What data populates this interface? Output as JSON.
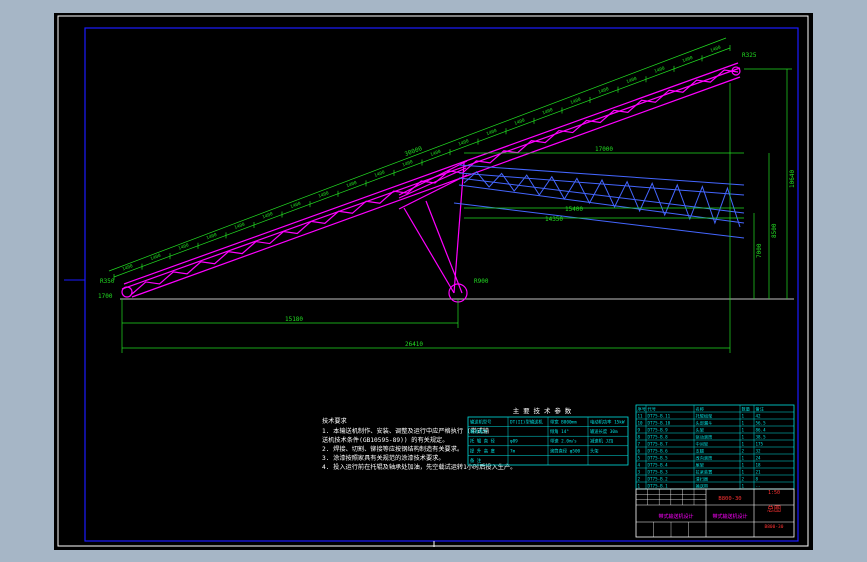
{
  "colors": {
    "background": "#a6b6c6",
    "sheet": "#000000",
    "frame": "#ffffff",
    "border": "#1a1aff",
    "structure": "#ff00ff",
    "dimensions": "#22dd22",
    "notes": "#ffffff",
    "title_block": "#00e0e0",
    "highlight": "#ff3333"
  },
  "dimensions": {
    "total_length": "26410",
    "bottom_length": "15180",
    "belt_length": "30000",
    "left_offset": "1700",
    "right_height": "10640",
    "height_mid": "8500",
    "height_low": "7000",
    "top_span": "17000",
    "mid_span": "15400",
    "inner_span": "14350",
    "rotation_radius": "R900",
    "top_end_mark": "R325",
    "left_end_mark": "R350",
    "segment_labels": [
      "1400",
      "1400",
      "1400",
      "1400",
      "1400",
      "1400",
      "1400",
      "1400",
      "1400",
      "1400",
      "1400",
      "1400",
      "1400",
      "1400",
      "1400",
      "1400",
      "1400",
      "1400",
      "1400",
      "1400",
      "1400",
      "1400"
    ]
  },
  "notes": {
    "title": "技术要求",
    "items": [
      "1. 本输送机制作、安装、调整及运行中应严格执行 (带式输",
      "   送机技术条件(GB10595-89)) 的有关规定。",
      "2. 焊接、切割、铆接等应按钢结构制造有关要求。",
      "3. 涂漆按照家具有关规范的涂漆技术要求。",
      "4. 投入运行前在托辊及轴承处加油，先空载试运转1小时后投入生产。"
    ]
  },
  "spec_table": {
    "title": "主 要 技 术 参 数",
    "rows": [
      [
        "输送机型号",
        "DT(II)型输送机",
        "带宽 B800mm",
        "电动机功率 15kW"
      ],
      [
        "输送能力",
        "",
        "倾角 14°",
        "输送长度 30m"
      ],
      [
        "托 辊 直 径",
        "φ89",
        "带速 2.0m/s",
        "减速机 JZQ"
      ],
      [
        "提 升 高 度",
        "7m",
        "滚筒直径 φ500",
        "头架"
      ],
      [
        "备 注",
        "",
        "",
        ""
      ]
    ]
  },
  "parts_list": {
    "header": [
      "序号",
      "代号",
      "名称",
      "数量",
      "备注"
    ],
    "rows": [
      [
        "11",
        "DT75-B.11",
        "托辊组架",
        "1",
        "42"
      ],
      [
        "10",
        "DT75-B.10",
        "头部漏斗",
        "1",
        "56.5"
      ],
      [
        "9",
        "DT75-B.9",
        "头架",
        "1",
        "86.4"
      ],
      [
        "8",
        "DT75-B.8",
        "驱动滚筒",
        "1",
        "38.5"
      ],
      [
        "7",
        "DT75-B.7",
        "中间架",
        "1",
        "175"
      ],
      [
        "6",
        "DT75-B.6",
        "支腿",
        "2",
        "32"
      ],
      [
        "5",
        "DT75-B.5",
        "改向滚筒",
        "1",
        "24"
      ],
      [
        "4",
        "DT75-B.4",
        "尾架",
        "1",
        "18"
      ],
      [
        "3",
        "DT75-B.3",
        "拉紧装置",
        "1",
        "21"
      ],
      [
        "2",
        "DT75-B.2",
        "清扫器",
        "2",
        "8"
      ],
      [
        "1",
        "DT75-B.1",
        "输送带",
        "1",
        "--"
      ]
    ]
  },
  "title_block": {
    "drawing_no": "B800-30",
    "scale_label": "1:50",
    "name": "总图",
    "company": "带式输送机设计"
  }
}
